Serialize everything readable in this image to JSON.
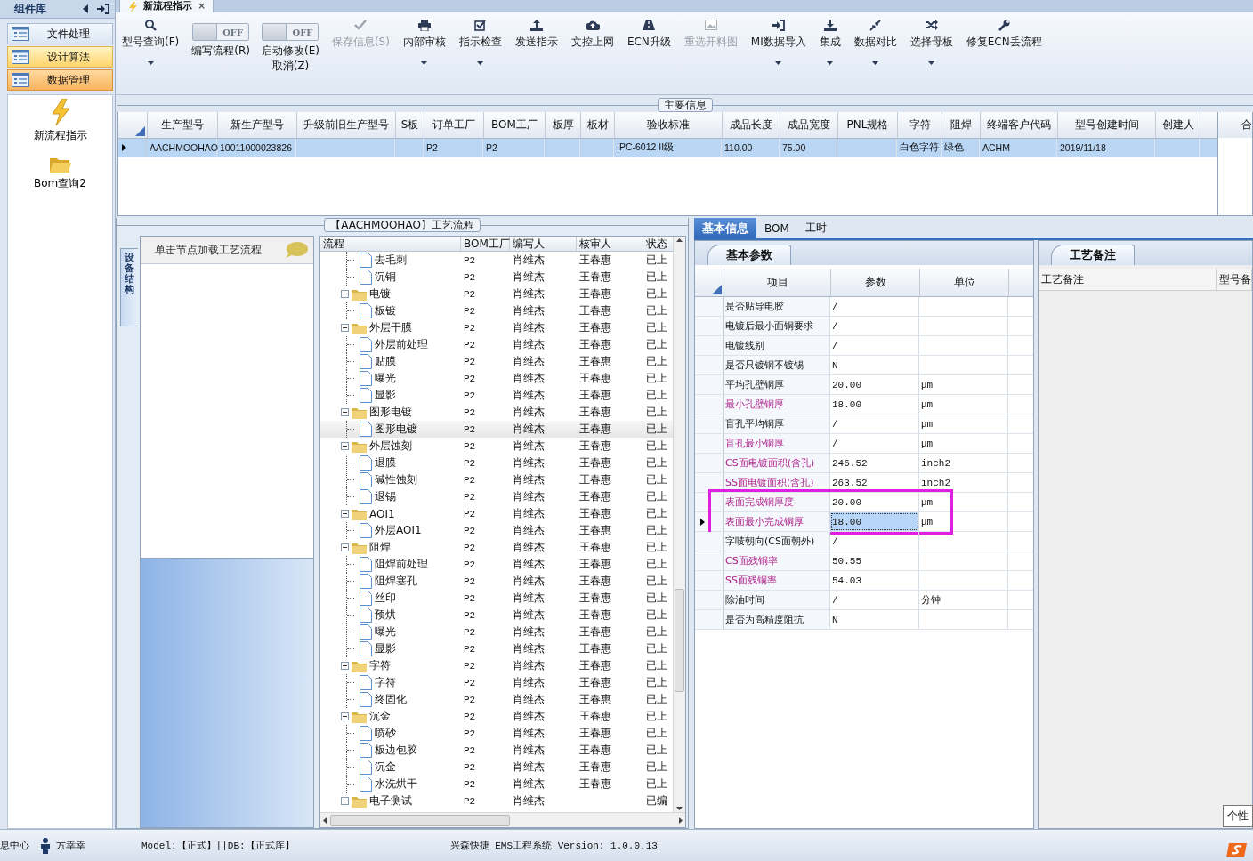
{
  "tab": {
    "title": "新流程指示",
    "close": "×"
  },
  "sidebar": {
    "title": "组件库",
    "items": [
      {
        "label": "文件处理",
        "selected": false,
        "hot": false
      },
      {
        "label": "设计算法",
        "selected": false,
        "hot": true
      },
      {
        "label": "数据管理",
        "selected": true,
        "hot": false
      }
    ],
    "launchers": [
      {
        "label": "新流程指示"
      },
      {
        "label": "Bom查询2"
      }
    ]
  },
  "toolbar": {
    "items": [
      {
        "kind": "button",
        "labels": [
          "型号查询(F)"
        ],
        "dropdown": true,
        "disabled": false
      },
      {
        "kind": "toggle",
        "labels": [
          "编写流程(R)"
        ],
        "on": false,
        "state_text": "OFF"
      },
      {
        "kind": "toggle",
        "labels": [
          "启动修改(E)",
          "取消(Z)"
        ],
        "on": false,
        "state_text": "OFF"
      },
      {
        "kind": "button",
        "labels": [
          "保存信息(S)"
        ],
        "dropdown": false,
        "disabled": true
      },
      {
        "kind": "button",
        "labels": [
          "内部审核"
        ],
        "dropdown": true,
        "disabled": false
      },
      {
        "kind": "button",
        "labels": [
          "指示检查"
        ],
        "dropdown": true,
        "disabled": false
      },
      {
        "kind": "button",
        "labels": [
          "发送指示"
        ],
        "dropdown": false,
        "disabled": false
      },
      {
        "kind": "button",
        "labels": [
          "文控上网"
        ],
        "dropdown": false,
        "disabled": false
      },
      {
        "kind": "button",
        "labels": [
          "ECN升级"
        ],
        "dropdown": false,
        "disabled": false
      },
      {
        "kind": "button",
        "labels": [
          "重选开料图"
        ],
        "dropdown": false,
        "disabled": true
      },
      {
        "kind": "button",
        "labels": [
          "MI数据导入"
        ],
        "dropdown": true,
        "disabled": false
      },
      {
        "kind": "button",
        "labels": [
          "集成"
        ],
        "dropdown": true,
        "disabled": false
      },
      {
        "kind": "button",
        "labels": [
          "数据对比"
        ],
        "dropdown": true,
        "disabled": false
      },
      {
        "kind": "button",
        "labels": [
          "选择母板"
        ],
        "dropdown": true,
        "disabled": false
      },
      {
        "kind": "button",
        "labels": [
          "修复ECN丢流程"
        ],
        "dropdown": false,
        "disabled": false
      }
    ]
  },
  "main_info": {
    "title": "主要信息",
    "columns": [
      "生产型号",
      "新生产型号",
      "升级前旧生产型号",
      "S板",
      "订单工厂",
      "BOM工厂",
      "板厚",
      "板材",
      "验收标准",
      "成品长度",
      "成品宽度",
      "PNL规格",
      "字符",
      "阻焊",
      "终端客户代码",
      "型号创建时间",
      "创建人"
    ],
    "rows": [
      {
        "selected": true,
        "cells": [
          "AACHMOOHAO",
          "10011000023826",
          null,
          null,
          "P2",
          "P2",
          null,
          null,
          "IPC-6012 II级",
          "110.00",
          "75.00",
          null,
          "白色字符",
          "绿色",
          "ACHM",
          "2019/11/18",
          null
        ]
      }
    ],
    "side_column": "合"
  },
  "process": {
    "title": "【AACHMOOHAO】工艺流程",
    "side_tab": "设备结构",
    "hint": "单击节点加载工艺流程",
    "columns": [
      "流程",
      "BOM工厂",
      "编写人",
      "核审人",
      "状态"
    ],
    "groups": [
      {
        "children": [
          {
            "label": "去毛刺",
            "bom": "P2",
            "writer": "肖维杰",
            "reviewer": "王春惠",
            "status": "已上",
            "selected": false
          },
          {
            "label": "沉铜",
            "bom": "P2",
            "writer": "肖维杰",
            "reviewer": "王春惠",
            "status": "已上",
            "selected": false
          }
        ]
      },
      {
        "label": "电镀",
        "bom": "P2",
        "writer": "肖维杰",
        "reviewer": "王春惠",
        "status": "已上",
        "expanded": true,
        "selected": false,
        "children": [
          {
            "label": "板镀",
            "bom": "P2",
            "writer": "肖维杰",
            "reviewer": "王春惠",
            "status": "已上",
            "selected": false
          }
        ]
      },
      {
        "label": "外层干膜",
        "bom": "P2",
        "writer": "肖维杰",
        "reviewer": "王春惠",
        "status": "已上",
        "expanded": true,
        "selected": false,
        "children": [
          {
            "label": "外层前处理",
            "bom": "P2",
            "writer": "肖维杰",
            "reviewer": "王春惠",
            "status": "已上",
            "selected": false
          },
          {
            "label": "贴膜",
            "bom": "P2",
            "writer": "肖维杰",
            "reviewer": "王春惠",
            "status": "已上",
            "selected": false
          },
          {
            "label": "曝光",
            "bom": "P2",
            "writer": "肖维杰",
            "reviewer": "王春惠",
            "status": "已上",
            "selected": false
          },
          {
            "label": "显影",
            "bom": "P2",
            "writer": "肖维杰",
            "reviewer": "王春惠",
            "status": "已上",
            "selected": false
          }
        ]
      },
      {
        "label": "图形电镀",
        "bom": "P2",
        "writer": "肖维杰",
        "reviewer": "王春惠",
        "status": "已上",
        "expanded": true,
        "selected": false,
        "children": [
          {
            "label": "图形电镀",
            "bom": "P2",
            "writer": "肖维杰",
            "reviewer": "王春惠",
            "status": "已上",
            "selected": true
          }
        ]
      },
      {
        "label": "外层蚀刻",
        "bom": "P2",
        "writer": "肖维杰",
        "reviewer": "王春惠",
        "status": "已上",
        "expanded": true,
        "selected": false,
        "children": [
          {
            "label": "退膜",
            "bom": "P2",
            "writer": "肖维杰",
            "reviewer": "王春惠",
            "status": "已上",
            "selected": false
          },
          {
            "label": "碱性蚀刻",
            "bom": "P2",
            "writer": "肖维杰",
            "reviewer": "王春惠",
            "status": "已上",
            "selected": false
          },
          {
            "label": "退锡",
            "bom": "P2",
            "writer": "肖维杰",
            "reviewer": "王春惠",
            "status": "已上",
            "selected": false
          }
        ]
      },
      {
        "label": "AOI1",
        "bom": "P2",
        "writer": "肖维杰",
        "reviewer": "王春惠",
        "status": "已上",
        "expanded": true,
        "selected": false,
        "children": [
          {
            "label": "外层AOI1",
            "bom": "P2",
            "writer": "肖维杰",
            "reviewer": "王春惠",
            "status": "已上",
            "selected": false
          }
        ]
      },
      {
        "label": "阻焊",
        "bom": "P2",
        "writer": "肖维杰",
        "reviewer": "王春惠",
        "status": "已上",
        "expanded": true,
        "selected": false,
        "children": [
          {
            "label": "阻焊前处理",
            "bom": "P2",
            "writer": "肖维杰",
            "reviewer": "王春惠",
            "status": "已上",
            "selected": false
          },
          {
            "label": "阻焊塞孔",
            "bom": "P2",
            "writer": "肖维杰",
            "reviewer": "王春惠",
            "status": "已上",
            "selected": false
          },
          {
            "label": "丝印",
            "bom": "P2",
            "writer": "肖维杰",
            "reviewer": "王春惠",
            "status": "已上",
            "selected": false
          },
          {
            "label": "预烘",
            "bom": "P2",
            "writer": "肖维杰",
            "reviewer": "王春惠",
            "status": "已上",
            "selected": false
          },
          {
            "label": "曝光",
            "bom": "P2",
            "writer": "肖维杰",
            "reviewer": "王春惠",
            "status": "已上",
            "selected": false
          },
          {
            "label": "显影",
            "bom": "P2",
            "writer": "肖维杰",
            "reviewer": "王春惠",
            "status": "已上",
            "selected": false
          }
        ]
      },
      {
        "label": "字符",
        "bom": "P2",
        "writer": "肖维杰",
        "reviewer": "王春惠",
        "status": "已上",
        "expanded": true,
        "selected": false,
        "children": [
          {
            "label": "字符",
            "bom": "P2",
            "writer": "肖维杰",
            "reviewer": "王春惠",
            "status": "已上",
            "selected": false
          },
          {
            "label": "终固化",
            "bom": "P2",
            "writer": "肖维杰",
            "reviewer": "王春惠",
            "status": "已上",
            "selected": false
          }
        ]
      },
      {
        "label": "沉金",
        "bom": "P2",
        "writer": "肖维杰",
        "reviewer": "王春惠",
        "status": "已上",
        "expanded": true,
        "selected": false,
        "children": [
          {
            "label": "喷砂",
            "bom": "P2",
            "writer": "肖维杰",
            "reviewer": "王春惠",
            "status": "已上",
            "selected": false
          },
          {
            "label": "板边包胶",
            "bom": "P2",
            "writer": "肖维杰",
            "reviewer": "王春惠",
            "status": "已上",
            "selected": false
          },
          {
            "label": "沉金",
            "bom": "P2",
            "writer": "肖维杰",
            "reviewer": "王春惠",
            "status": "已上",
            "selected": false
          },
          {
            "label": "水洗烘干",
            "bom": "P2",
            "writer": "肖维杰",
            "reviewer": "王春惠",
            "status": "已上",
            "selected": false
          }
        ]
      },
      {
        "label": "电子测试",
        "bom": "P2",
        "writer": "肖维杰",
        "status": "已编",
        "expanded": true,
        "selected": false
      }
    ]
  },
  "detail": {
    "tabs": [
      {
        "label": "基本信息",
        "selected": true
      },
      {
        "label": "BOM",
        "selected": false
      },
      {
        "label": "工时",
        "selected": false
      }
    ],
    "params": {
      "tab": "基本参数",
      "columns": [
        "项目",
        "参数",
        "单位"
      ],
      "rows": [
        {
          "name": "是否贴导电胶",
          "value": "/",
          "flagged": false,
          "selected": false,
          "boxed": false
        },
        {
          "name": "电镀后最小面铜要求",
          "value": "/",
          "flagged": false,
          "selected": false,
          "boxed": false
        },
        {
          "name": "电镀线别",
          "value": "/",
          "flagged": false,
          "selected": false,
          "boxed": false
        },
        {
          "name": "是否只镀铜不镀锡",
          "value": "N",
          "flagged": false,
          "selected": false,
          "boxed": false
        },
        {
          "name": "平均孔壁铜厚",
          "value": "20.00",
          "unit": "μm",
          "flagged": false,
          "selected": false,
          "boxed": false
        },
        {
          "name": "最小孔壁铜厚",
          "value": "18.00",
          "unit": "μm",
          "flagged": true,
          "selected": false,
          "boxed": false
        },
        {
          "name": "盲孔平均铜厚",
          "value": "/",
          "unit": "μm",
          "flagged": false,
          "selected": false,
          "boxed": false
        },
        {
          "name": "盲孔最小铜厚",
          "value": "/",
          "unit": "μm",
          "flagged": true,
          "selected": false,
          "boxed": false
        },
        {
          "name": "CS面电镀面积(含孔)",
          "value": "246.52",
          "unit": "inch2",
          "flagged": true,
          "selected": false,
          "boxed": false
        },
        {
          "name": "SS面电镀面积(含孔)",
          "value": "263.52",
          "unit": "inch2",
          "flagged": true,
          "selected": false,
          "boxed": false
        },
        {
          "name": "表面完成铜厚度",
          "value": "20.00",
          "unit": "μm",
          "flagged": true,
          "selected": false,
          "boxed": true
        },
        {
          "name": "表面最小完成铜厚",
          "value": "18.00",
          "unit": "μm",
          "flagged": true,
          "selected": true,
          "boxed": true
        },
        {
          "name": "字唛朝向(CS面朝外)",
          "value": "/",
          "flagged": false,
          "selected": false,
          "boxed": false
        },
        {
          "name": "CS面残铜率",
          "value": "50.55",
          "flagged": true,
          "selected": false,
          "boxed": false
        },
        {
          "name": "SS面残铜率",
          "value": "54.03",
          "flagged": true,
          "selected": false,
          "boxed": false
        },
        {
          "name": "除油时间",
          "value": "/",
          "unit": "分钟",
          "flagged": false,
          "selected": false,
          "boxed": false
        },
        {
          "name": "是否为高精度阻抗",
          "value": "N",
          "flagged": false,
          "selected": false,
          "boxed": false
        }
      ]
    },
    "remarks": {
      "tab": "工艺备注",
      "columns": [
        "工艺备注",
        "型号备"
      ]
    }
  },
  "status_bar": {
    "info": "息中心",
    "user": "方幸幸",
    "model": "Model:【正式】||DB:【正式库】",
    "version": "兴森快捷 EMS工程系统 Version: 1.0.0.13",
    "tooltip": "个性"
  }
}
